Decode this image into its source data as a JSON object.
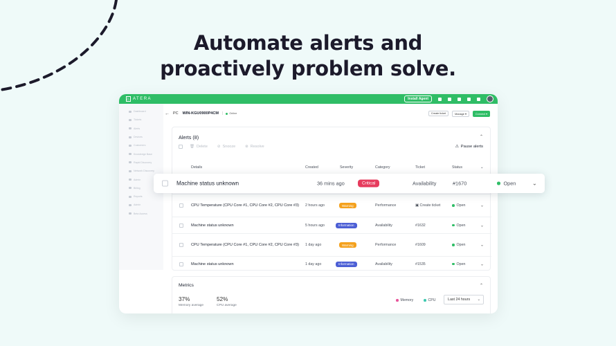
{
  "headline": {
    "line1": "Automate alerts and",
    "line2": "proactively problem solve."
  },
  "topbar": {
    "logo": "ATERA",
    "install_agent": "Install Agent"
  },
  "sidebar": {
    "items": [
      "Dashboard",
      "Tickets",
      "Alerts",
      "Devices",
      "Customers",
      "Knowledge Base",
      "Rapid Discovery",
      "Network Discovery",
      "Admin",
      "Billing",
      "Reports",
      "Admin",
      "Beta Access"
    ]
  },
  "breadcrumb": {
    "pc": "PC",
    "device_name": "WIN-KGU0900P4CM",
    "online": "Online",
    "create_ticket": "Create ticket",
    "manage": "Manage",
    "connect": "Connect"
  },
  "alerts": {
    "title": "Alerts (8)",
    "tools": {
      "delete": "Delete",
      "snooze": "Snooze",
      "resolve": "Resolve",
      "pause_alerts": "Pause alerts"
    },
    "headers": {
      "details": "Details",
      "created": "Created",
      "severity": "Severity",
      "category": "Category",
      "ticket": "Ticket",
      "status": "Status"
    },
    "rows": [
      {
        "details": "CPU Temperature (CPU Core #1, CPU Core #2, CPU Core #3)",
        "created": "2 hours ago",
        "severity": "Warning",
        "category": "Performance",
        "ticket": "Create ticket",
        "status": "Open"
      },
      {
        "details": "Machine status unknown",
        "created": "5 hours ago",
        "severity": "Information",
        "category": "Availability",
        "ticket": "#1632",
        "status": "Open"
      },
      {
        "details": "CPU Temperature (CPU Core #1, CPU Core #2, CPU Core #3)",
        "created": "1 day ago",
        "severity": "Warning",
        "category": "Performance",
        "ticket": "#1609",
        "status": "Open"
      },
      {
        "details": "Machine status unknown",
        "created": "1 day ago",
        "severity": "Information",
        "category": "Availability",
        "ticket": "#1535",
        "status": "Open"
      }
    ]
  },
  "highlighted_alert": {
    "details": "Machine status unknown",
    "created": "36 mins ago",
    "severity": "Critical",
    "category": "Availability",
    "ticket": "#1670",
    "status": "Open"
  },
  "metrics": {
    "title": "Metrics",
    "memory_value": "37%",
    "memory_label": "Memory average",
    "cpu_value": "52%",
    "cpu_label": "CPU average",
    "legend_memory": "Memory",
    "legend_cpu": "CPU",
    "range": "Last 24 hours"
  },
  "colors": {
    "brand": "#2fbd66",
    "critical": "#e63b5d",
    "warning": "#f4a11d",
    "information": "#4c5fd5",
    "memory": "#e8559a",
    "cpu": "#3fc9b0"
  }
}
